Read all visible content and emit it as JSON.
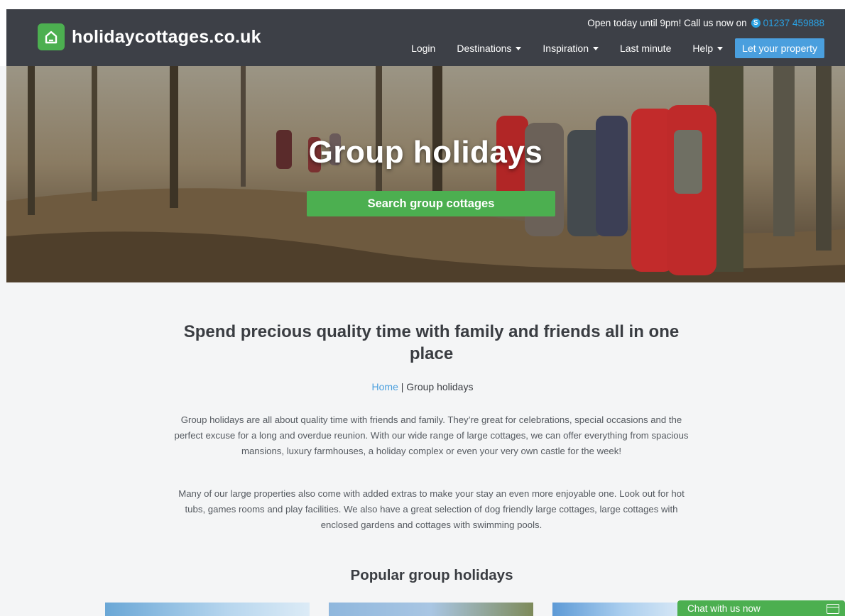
{
  "header": {
    "logo_text": "holidaycottages.co.uk",
    "topline_text": "Open today until 9pm! Call us now on",
    "phone": "01237 459888",
    "nav": {
      "login": "Login",
      "destinations": "Destinations",
      "inspiration": "Inspiration",
      "last_minute": "Last minute",
      "help": "Help",
      "let_property": "Let your property"
    }
  },
  "hero": {
    "title": "Group holidays",
    "button": "Search group cottages"
  },
  "content": {
    "heading": "Spend precious quality time with family and friends all in one place",
    "breadcrumb_home": "Home",
    "breadcrumb_sep": "|",
    "breadcrumb_current": "Group holidays",
    "paragraph1": "Group holidays are all about quality time with friends and family. They’re great for celebrations, special occasions and the perfect excuse for a long and overdue reunion. With our wide range of large cottages, we can offer everything from spacious mansions, luxury farmhouses, a holiday complex or even your very own castle for the week!",
    "paragraph2": "Many of our large properties also come with added extras to make your stay an even more enjoyable one. Look out for hot tubs, games rooms and play facilities. We also have a great selection of dog friendly large cottages, large cottages with enclosed gardens and cottages with swimming pools.",
    "popular_heading": "Popular group holidays"
  },
  "chat": {
    "label": "Chat with us now"
  },
  "colors": {
    "header_bg": "#3d4047",
    "brand_green": "#4caf50",
    "accent_blue": "#4a9fde",
    "page_bg": "#f4f5f6"
  }
}
